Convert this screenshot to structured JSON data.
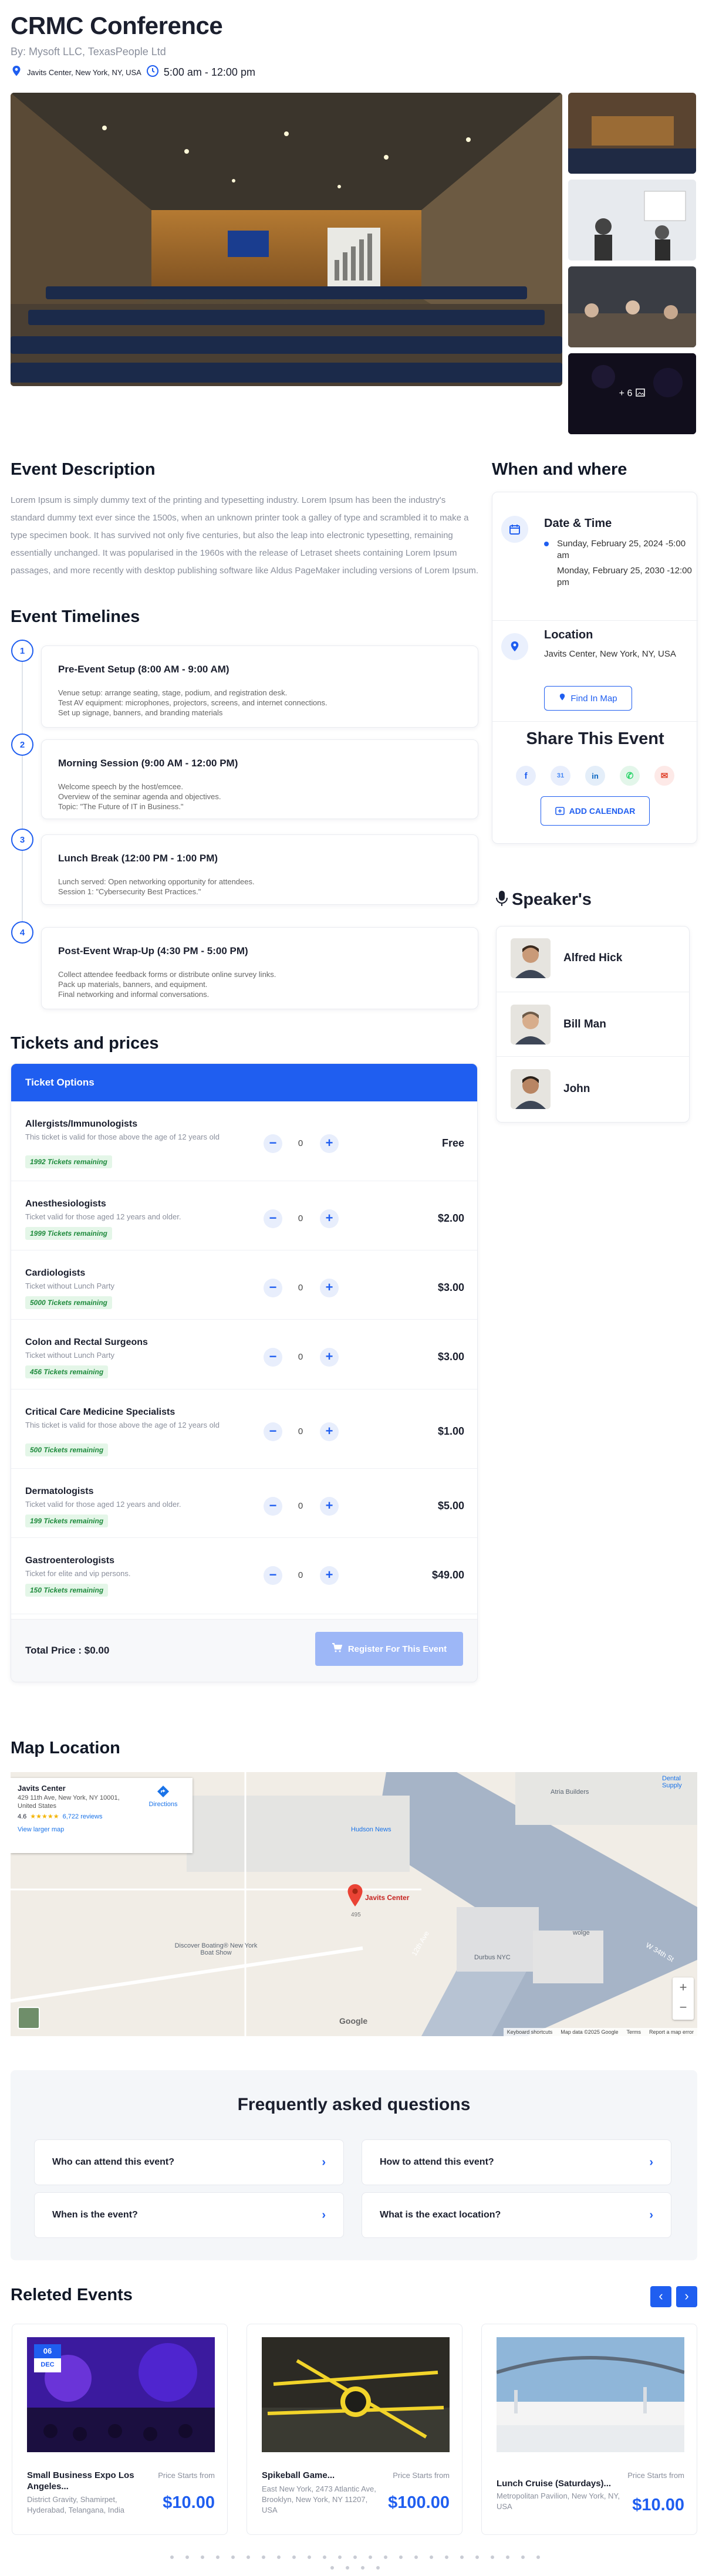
{
  "header": {
    "title": "CRMC Conference",
    "organizer": "By:  Mysoft LLC, TexasPeople Ltd",
    "location": "Javits Center, New York, NY, USA",
    "time": "5:00 am - 12:00 pm"
  },
  "gallery": {
    "more_label": "+ 6"
  },
  "description": {
    "heading": "Event Description",
    "text": "Lorem Ipsum is simply dummy text of the printing and typesetting industry. Lorem Ipsum has been the industry's standard dummy text ever since the 1500s, when an unknown printer took a galley of type and scrambled it to make a type specimen book. It has survived not only five centuries, but also the leap into electronic typesetting, remaining essentially unchanged. It was popularised in the 1960s with the release of Letraset sheets containing Lorem Ipsum passages, and more recently with desktop publishing software like Aldus PageMaker including versions of Lorem Ipsum."
  },
  "timelines": {
    "heading": "Event Timelines",
    "items": [
      {
        "num": "1",
        "title": "Pre-Event Setup (8:00 AM - 9:00 AM)",
        "lines": [
          "Venue setup: arrange seating, stage, podium, and registration desk.",
          "Test AV equipment: microphones, projectors, screens, and internet connections.",
          "Set up signage, banners, and branding materials"
        ]
      },
      {
        "num": "2",
        "title": "Morning Session (9:00 AM - 12:00 PM)",
        "lines": [
          "Welcome speech by the host/emcee.",
          "Overview of the seminar agenda and objectives.",
          "Topic: \"The Future of IT in Business.\""
        ]
      },
      {
        "num": "3",
        "title": "Lunch Break (12:00 PM - 1:00 PM)",
        "lines": [
          "Lunch served: Open networking opportunity for attendees.",
          "Session 1: \"Cybersecurity Best Practices.\""
        ]
      },
      {
        "num": "4",
        "title": "Post-Event Wrap-Up (4:30 PM - 5:00 PM)",
        "lines": [
          "Collect attendee feedback forms or distribute online survey links.",
          "Pack up materials, banners, and equipment.",
          "Final networking and informal conversations."
        ]
      }
    ]
  },
  "when_where": {
    "heading": "When and where",
    "date_title": "Date & Time",
    "date_bullet": "Sunday, February 25, 2024 -5:00 am",
    "date_extra": "Monday, February 25, 2030 -12:00 pm",
    "location_title": "Location",
    "location_value": "Javits Center, New York, NY, USA",
    "find_in_map": "Find In Map"
  },
  "share": {
    "heading": "Share This Event",
    "add_calendar": "ADD CALENDAR",
    "icons": [
      "facebook-icon",
      "google-calendar-icon",
      "linkedin-icon",
      "whatsapp-icon",
      "email-icon"
    ]
  },
  "speakers": {
    "heading": "Speaker's",
    "list": [
      {
        "name": "Alfred Hick"
      },
      {
        "name": "Bill Man"
      },
      {
        "name": "John"
      }
    ]
  },
  "tickets": {
    "heading": "Tickets and prices",
    "panel_title": "Ticket Options",
    "items": [
      {
        "name": "Allergists/Immunologists",
        "desc": "This ticket is valid for those above the age of 12 years old",
        "remaining": "1992 Tickets remaining",
        "qty": "0",
        "price": "Free"
      },
      {
        "name": "Anesthesiologists",
        "desc": "Ticket valid for those aged 12 years and older.",
        "remaining": "1999 Tickets remaining",
        "qty": "0",
        "price": "$2.00"
      },
      {
        "name": "Cardiologists",
        "desc": "Ticket without Lunch Party",
        "remaining": "5000 Tickets remaining",
        "qty": "0",
        "price": "$3.00"
      },
      {
        "name": "Colon and Rectal Surgeons",
        "desc": "Ticket without Lunch Party",
        "remaining": "456 Tickets remaining",
        "qty": "0",
        "price": "$3.00"
      },
      {
        "name": "Critical Care Medicine Specialists",
        "desc": "This ticket is valid for those above the age of 12 years old",
        "remaining": "500 Tickets remaining",
        "qty": "0",
        "price": "$1.00"
      },
      {
        "name": "Dermatologists",
        "desc": "Ticket valid for those aged 12 years and older.",
        "remaining": "199 Tickets remaining",
        "qty": "0",
        "price": "$5.00"
      },
      {
        "name": "Gastroenterologists",
        "desc": "Ticket for elite and vip persons.",
        "remaining": "150 Tickets remaining",
        "qty": "0",
        "price": "$49.00"
      }
    ],
    "total_label": "Total Price : $0.00",
    "register_label": "Register For This Event"
  },
  "map": {
    "heading": "Map Location",
    "place_name": "Javits Center",
    "place_address": "429 11th Ave, New York, NY 10001, United States",
    "rating": "4.6",
    "reviews": "6,722 reviews",
    "view_larger": "View larger map",
    "directions": "Directions",
    "pin_label": "Javits Center",
    "labels": [
      "Atria Builders",
      "Hudson News",
      "Discover Boating® New York Boat Show",
      "Durbus NYC",
      "Dental Supply",
      "wolge",
      "12th Ave",
      "W 34th St",
      "495",
      "Google"
    ],
    "footer": [
      "Keyboard shortcuts",
      "Map data ©2025 Google",
      "Terms",
      "Report a map error"
    ]
  },
  "faq": {
    "heading": "Frequently asked questions",
    "items": [
      "Who can attend this event?",
      "How to attend this event?",
      "When is the event?",
      "What is the exact location?"
    ]
  },
  "related": {
    "heading": "Releted Events",
    "events": [
      {
        "title": "Small Business Expo Los Angeles...",
        "address": "District Gravity, Shamirpet, Hyderabad, Telangana, India",
        "price_label": "Price Starts from",
        "price": "$10.00",
        "date_day": "06",
        "date_month": "DEC"
      },
      {
        "title": "Spikeball Game...",
        "address": "East New York, 2473 Atlantic Ave, Brooklyn, New York, NY 11207, USA",
        "price_label": "Price Starts from",
        "price": "$100.00"
      },
      {
        "title": "Lunch Cruise (Saturdays)...",
        "address": "Metropolitan Pavilion, New York, NY, USA",
        "price_label": "Price Starts from",
        "price": "$10.00"
      }
    ]
  },
  "colors": {
    "accent": "#1f5ef0",
    "badge_bg": "#e4f6e8",
    "badge_text": "#1e8a3c"
  }
}
